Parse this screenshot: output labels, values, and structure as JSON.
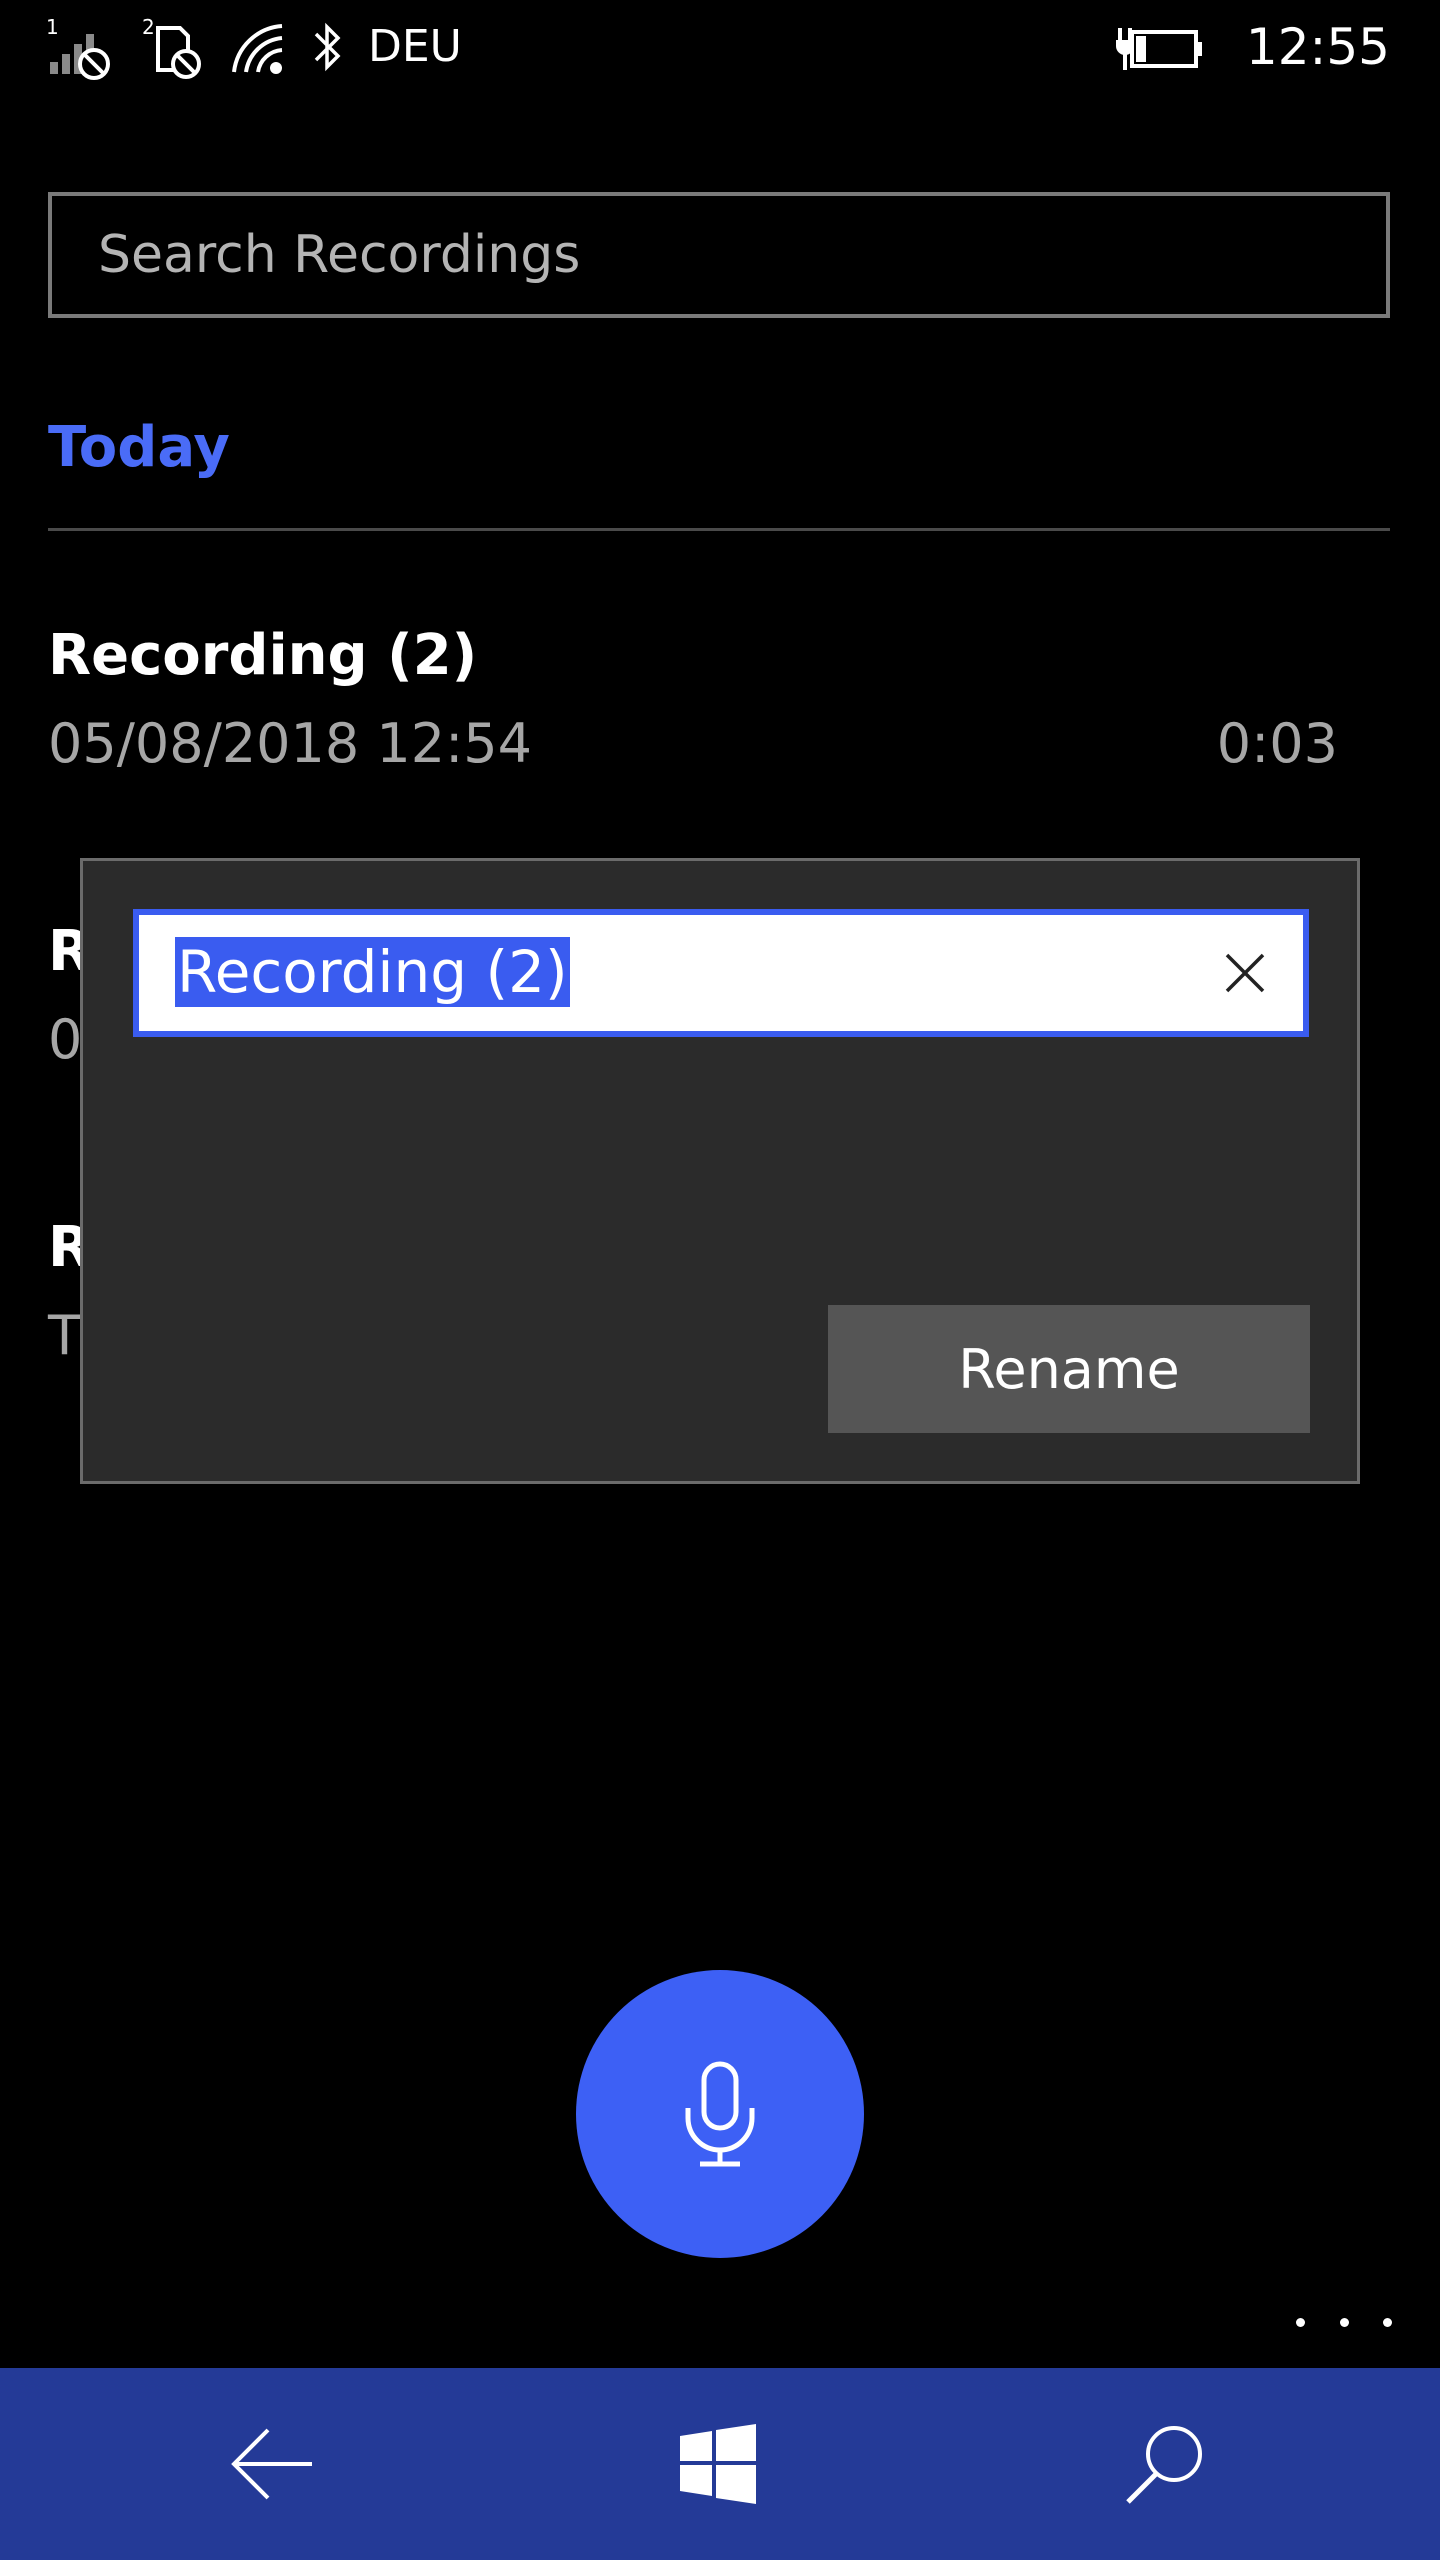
{
  "status_bar": {
    "sim1_label": "1",
    "sim2_label": "2",
    "carrier": "DEU",
    "time": "12:55",
    "icons": [
      "signal-no-service-icon",
      "sim2-no-service-icon",
      "wifi-icon",
      "bluetooth-icon",
      "battery-charging-icon"
    ]
  },
  "search": {
    "placeholder": "Search Recordings",
    "value": ""
  },
  "group": {
    "header": "Today"
  },
  "recordings": [
    {
      "title": "Recording (2)",
      "date": "05/08/2018 12:54",
      "duration": "0:03"
    },
    {
      "title": "R",
      "date": "0",
      "duration": ""
    },
    {
      "title": "R",
      "date": "T",
      "duration": ""
    }
  ],
  "rename_dialog": {
    "value": "Recording (2)",
    "button_label": "Rename",
    "clear_icon": "close-icon"
  },
  "record_button": {
    "icon": "microphone-icon"
  },
  "app_bar": {
    "more_icon": "more-dots-icon"
  },
  "nav_bar": {
    "icons": [
      "back-arrow-icon",
      "windows-start-icon",
      "search-icon"
    ]
  },
  "colors": {
    "accent": "#3d60f5",
    "accent_text": "#4a6cf7",
    "nav_bar": "#243a97",
    "popup": "#2b2b2b",
    "button": "#555555",
    "secondary_text": "#a6a6a6"
  }
}
